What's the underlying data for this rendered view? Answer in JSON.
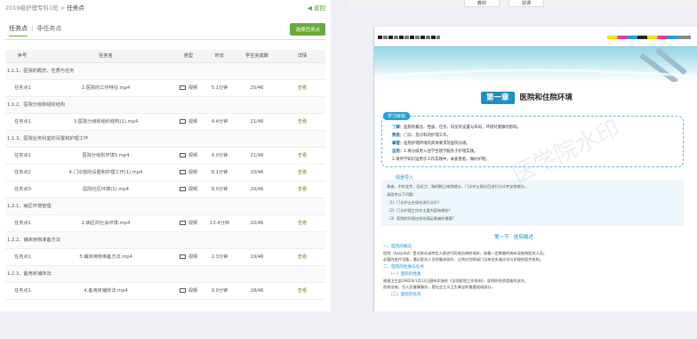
{
  "header": {
    "breadcrumb_parent": "2019级护理专科1班",
    "breadcrumb_sep": " > ",
    "breadcrumb_current": "任务点",
    "back_label": "返回"
  },
  "tabs": {
    "active": "任务点",
    "separator": "|",
    "inactive": "非任务点"
  },
  "select_task_label": "选择任务点",
  "table": {
    "columns": [
      "序号",
      "任务名",
      "类型",
      "时长",
      "学生完成数",
      "详情"
    ],
    "rows": [
      {
        "kind": "section",
        "label": "1.1.1、医院的概念、性质与任务"
      },
      {
        "kind": "task",
        "no": "任务点1",
        "name": "2.医院的工作特征.mp4",
        "type": "视频",
        "duration": "5.1分钟",
        "done": "25/46",
        "detail": "查看"
      },
      {
        "kind": "section",
        "label": "1.1.2、医院分级和组织结构"
      },
      {
        "kind": "task",
        "no": "任务点1",
        "name": "3.医院分级和组织结构(1).mp4",
        "type": "视频",
        "duration": "4.4分钟",
        "done": "21/46",
        "detail": "查看"
      },
      {
        "kind": "section",
        "label": "1.1.3、医院业务科室的设置和护理工作"
      },
      {
        "kind": "task",
        "no": "任务点1",
        "name": "医院分级别环境5.mp4",
        "type": "视频",
        "duration": "4.0分钟",
        "done": "21/46",
        "detail": "查看"
      },
      {
        "kind": "task",
        "no": "任务点2",
        "name": "4.门诊部的设置和护理工作(1).mp4",
        "type": "视频",
        "duration": "8.1分钟",
        "done": "20/46",
        "detail": "查看"
      },
      {
        "kind": "task",
        "no": "任务点3",
        "name": "医院社区环境(1).mp4",
        "type": "视频",
        "duration": "8.0分钟",
        "done": "20/46",
        "detail": "查看"
      },
      {
        "kind": "section",
        "label": "1.2.1、病区环境管理"
      },
      {
        "kind": "task",
        "no": "任务点1",
        "name": "2.病区的社会环境.mp4",
        "type": "视频",
        "duration": "13.4分钟",
        "done": "20/46",
        "detail": "查看"
      },
      {
        "kind": "section",
        "label": "1.2.2、铺床用物准备方法"
      },
      {
        "kind": "task",
        "no": "任务点1",
        "name": "3.铺床用物准备方法.mp4",
        "type": "视频",
        "duration": "2.3分钟",
        "done": "19/46",
        "detail": "查看"
      },
      {
        "kind": "section",
        "label": "1.2.3、备用床铺床法"
      },
      {
        "kind": "task",
        "no": "任务点1",
        "name": "4.备用床铺床法.mp4",
        "type": "视频",
        "duration": "9.0分钟",
        "done": "18/46",
        "detail": "查看"
      }
    ]
  },
  "viewer": {
    "tab_textbook": "教材",
    "tab_teach": "授课",
    "chapter_badge": "第一章",
    "chapter_title": "医院和住院环境",
    "goals_title": "学习目标",
    "goals": [
      {
        "k": "了解：",
        "v": "医院的概念、性质、任务，科室的设置与布局，环境对健康的影响。"
      },
      {
        "k": "熟悉：",
        "v": "门诊、急诊科的护理工作。"
      },
      {
        "k": "掌握：",
        "v": "医院护理环境的具体要求及医院分级。"
      },
      {
        "k": "运用：",
        "v": "1.将分级用入住学生理学服务于护理实践。"
      },
      {
        "k": "",
        "v": "2.将所学知识运用于工作实践中，关爱患者，做好护理。"
      }
    ],
    "case_title": "情景导入",
    "case_lines": [
      "患者，中年女性，因乏力、胸闷数日来院就诊，门诊护士接诊后进行分诊并安排就诊。",
      "请思考以下问题：",
      "（1）门诊护士应如何进行分诊？",
      "（2）门诊护理工作的主要内容有哪些？",
      "（3）医院的环境应如何满足患者的需要？"
    ],
    "section_title": "第一节　医院概述",
    "h1": "一、医院的概念",
    "p1": "医院（hospital）是对群众或特定人群进行防病治病的场所，具备一定数量的病床设施和医务人员。",
    "p2": "必要的医疗设备，通过医务人员的集体协作，达到对住院或门诊病员实施诊治与护理的医疗机构。",
    "h2": "二、医院的性质与任务",
    "h3": "（一）医院的性质",
    "p3": "根据卫生部1982年1月12日颁布实施的《全国医院工作条例》，医院的性质是救死扶伤，",
    "p4": "防病治病，为人民健康服务，是社会主义卫生事业的重要组成部分。",
    "h4": "（二）医院的任务",
    "watermark": "医学院水印"
  }
}
